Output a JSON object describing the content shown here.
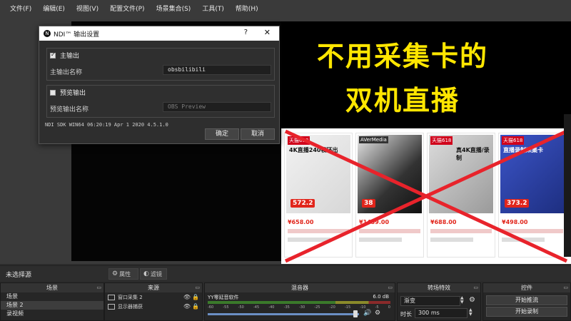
{
  "menu": [
    "文件(F)",
    "编辑(E)",
    "视图(V)",
    "配置文件(P)",
    "场景集合(S)",
    "工具(T)",
    "帮助(H)"
  ],
  "thumbnail": {
    "line1": "不用采集卡的",
    "line2": "双机直播",
    "products": [
      {
        "badge": "天猫618",
        "caption": "4K直播240帧环出",
        "price": "¥658.00",
        "tag": "572.2"
      },
      {
        "badge": "AVerMedia",
        "caption": "",
        "price": "¥1459.00",
        "tag": "38"
      },
      {
        "badge": "天猫618",
        "caption": "真4K直播/录制",
        "price": "¥688.00",
        "tag": ""
      },
      {
        "badge": "天猫618",
        "caption": "直播录制采集卡",
        "price": "¥498.00",
        "tag": "373.2"
      }
    ]
  },
  "dialog": {
    "title": "NDI™ 输出设置",
    "help": "?",
    "close": "✕",
    "main_output_checkbox": "主输出",
    "main_output_label": "主输出名称",
    "main_output_value": "obsbilibili",
    "preview_output_checkbox": "预览输出",
    "preview_output_label": "预览输出名称",
    "preview_output_value": "OBS Preview",
    "sdk_info": "NDI SDK WIN64 06:20:19 Apr  1 2020 4.5.1.0",
    "ok": "确定",
    "cancel": "取消"
  },
  "status": {
    "no_source": "未选择源",
    "properties": "属性",
    "filters": "滤镜"
  },
  "docks": {
    "scenes": {
      "title": "场景",
      "items": [
        "场景",
        "场景 2",
        "录视频"
      ]
    },
    "sources": {
      "title": "来源",
      "items": [
        "窗口采集 2",
        "显示器捕获"
      ]
    },
    "mixer": {
      "title": "混音器",
      "track": "YY零延音软件",
      "db": "6.0 dB",
      "scale": [
        "-60",
        "-55",
        "-50",
        "-45",
        "-40",
        "-35",
        "-30",
        "-25",
        "-20",
        "-15",
        "-10",
        "-5",
        "0"
      ]
    },
    "transitions": {
      "title": "转场特效",
      "type": "渐变",
      "duration_label": "时长",
      "duration": "300 ms"
    },
    "controls": {
      "title": "控件",
      "start_stream": "开始推流",
      "start_record": "开始录制"
    }
  }
}
